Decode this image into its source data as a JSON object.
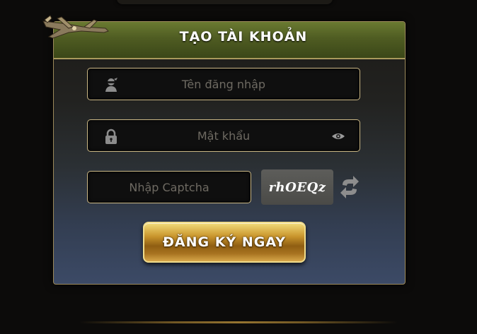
{
  "header": {
    "title": "TẠO TÀI KHOẢN"
  },
  "form": {
    "username": {
      "placeholder": "Tên đăng nhập",
      "value": ""
    },
    "password": {
      "placeholder": "Mật khẩu",
      "value": ""
    },
    "captcha": {
      "placeholder": "Nhập Captcha",
      "value": "",
      "code": "rhOEQz"
    },
    "submit_label": "ĐĂNG KÝ NGAY"
  },
  "icons": {
    "logo": "airplane-logo-icon",
    "username": "user-ninja-icon",
    "password": "lock-icon",
    "toggle_password": "eye-icon",
    "refresh_captcha": "refresh-icon"
  },
  "colors": {
    "header_green": "#5a6a28",
    "button_gold": "#c9952c",
    "field_border": "#c9b684"
  }
}
